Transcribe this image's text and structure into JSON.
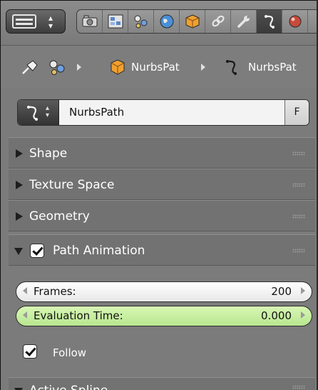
{
  "toolbar": {
    "editor_type_icon": "properties-editor-icon",
    "context_tabs": [
      {
        "name": "render-tab",
        "icon": "camera-icon",
        "active": false
      },
      {
        "name": "render-layers-tab",
        "icon": "layers-icon",
        "active": false
      },
      {
        "name": "scene-tab",
        "icon": "scene-icon",
        "active": false
      },
      {
        "name": "world-tab",
        "icon": "world-icon",
        "active": false
      },
      {
        "name": "object-tab",
        "icon": "object-cube-icon",
        "active": false
      },
      {
        "name": "constraints-tab",
        "icon": "chain-link-icon",
        "active": false
      },
      {
        "name": "modifiers-tab",
        "icon": "wrench-icon",
        "active": false
      },
      {
        "name": "curve-data-tab",
        "icon": "curve-icon",
        "active": true
      },
      {
        "name": "material-tab",
        "icon": "material-sphere-icon",
        "active": false
      }
    ]
  },
  "breadcrumb": {
    "pin_icon": "pin-icon",
    "scene_icon": "scene-icon",
    "object_name": "NurbsPat",
    "data_name": "NurbsPat"
  },
  "datablock": {
    "name": "NurbsPath",
    "fake_user": "F"
  },
  "panels": [
    {
      "label": "Shape",
      "expanded": false
    },
    {
      "label": "Texture Space",
      "expanded": false
    },
    {
      "label": "Geometry",
      "expanded": false
    },
    {
      "label": "Path Animation",
      "expanded": true,
      "enabled": true
    },
    {
      "label": "Active Spline",
      "expanded": false
    }
  ],
  "path_animation": {
    "frames_label": "Frames:",
    "frames_value": "200",
    "eval_time_label": "Evaluation Time:",
    "eval_time_value": "0.000",
    "follow_label": "Follow",
    "follow_checked": true
  },
  "colors": {
    "panel_bg": "#7b7b7b",
    "animated_field": "#c6eda0",
    "field_bg": "#f3f3f3"
  }
}
